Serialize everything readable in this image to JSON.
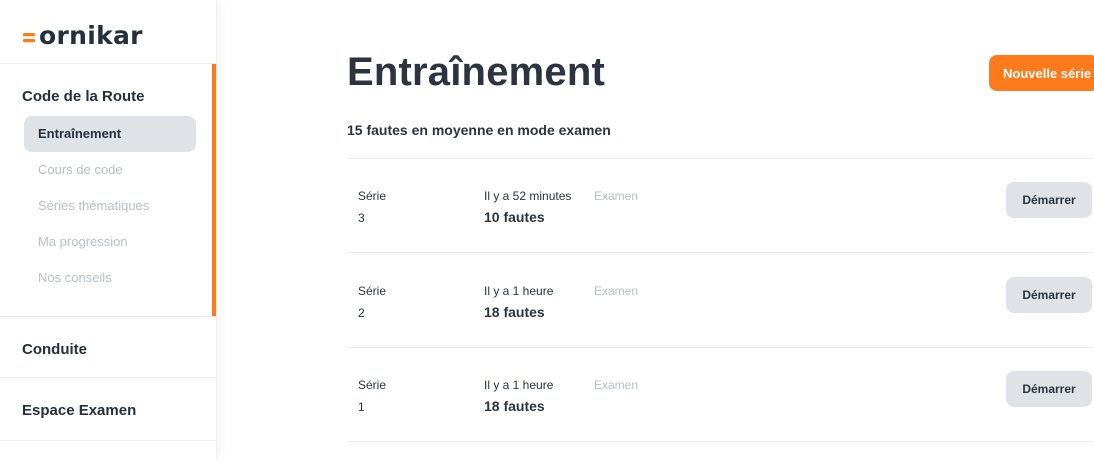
{
  "brand": {
    "name": "ornikar",
    "accent": "#ff7a1a"
  },
  "sidebar": {
    "sections": [
      {
        "title": "Code de la Route",
        "items": [
          {
            "label": "Entraînement",
            "selected": true
          },
          {
            "label": "Cours de code"
          },
          {
            "label": "Séries thématiques"
          },
          {
            "label": "Ma progression"
          },
          {
            "label": "Nos conseils"
          }
        ]
      },
      {
        "title": "Conduite"
      },
      {
        "title": "Espace Examen"
      }
    ]
  },
  "main": {
    "title": "Entraînement",
    "new_series_label": "Nouvelle série",
    "summary": "15 fautes en moyenne en mode examen",
    "rows": [
      {
        "serie_label": "Série",
        "serie_number": "3",
        "time": "Il y a 52 minutes",
        "mode": "Examen",
        "faults": "10 fautes",
        "action": "Démarrer"
      },
      {
        "serie_label": "Série",
        "serie_number": "2",
        "time": "Il y a 1 heure",
        "mode": "Examen",
        "faults": "18 fautes",
        "action": "Démarrer"
      },
      {
        "serie_label": "Série",
        "serie_number": "1",
        "time": "Il y a 1 heure",
        "mode": "Examen",
        "faults": "18 fautes",
        "action": "Démarrer"
      }
    ]
  }
}
